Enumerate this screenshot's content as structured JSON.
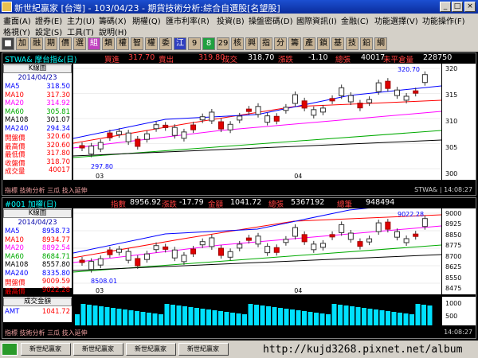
{
  "title": "新世紀贏家 [台灣] - 103/04/23 - 期貨技術分析:綜合自選股[名望股]",
  "menu1": [
    "畫面(A)",
    "證券(E)",
    "主力(U)",
    "籌碼(X)",
    "期權(Q)",
    "匯市利率(R)",
    "投資(B)",
    "操盤密碼(D)",
    "國際資訊(I)",
    "金融(C)",
    "功能選擇(V)",
    "功能操作(F)"
  ],
  "menu2": [
    "格視(Y)",
    "設定(S)",
    "工具(T)",
    "說明(H)"
  ],
  "toolbar": [
    "加",
    "融",
    "期",
    "價",
    "選",
    "組",
    "類",
    "權",
    "智",
    "權",
    "委",
    "江",
    "9",
    "8",
    "29",
    "核",
    "興",
    "指",
    "分",
    "籌",
    "產",
    "鎖",
    "基",
    "技",
    "鉛",
    "綱"
  ],
  "top": {
    "symbol": "STWA& 摩台指&(日)",
    "buy_label": "買進",
    "buy": "317.70",
    "sell_label": "賣出",
    "sell": "319.80",
    "deal_label": "成交",
    "deal": "318.70",
    "chg_label": "漲跌",
    "chg": "-1.10",
    "vol_label": "總張",
    "vol": "40017",
    "oi_label": "未平倉量",
    "oi": "228750",
    "header": "K線圖",
    "date": "2014/04/23",
    "rows": [
      {
        "label": "MA5",
        "value": "318.50",
        "color": "#0000ff"
      },
      {
        "label": "MA10",
        "value": "317.30",
        "color": "#ff0000"
      },
      {
        "label": "MA20",
        "value": "314.92",
        "color": "#ff00ff"
      },
      {
        "label": "MA60",
        "value": "305.81",
        "color": "#00aa00"
      },
      {
        "label": "MA108",
        "value": "301.07",
        "color": "#000000"
      },
      {
        "label": "MA240",
        "value": "294.34",
        "color": "#0000ff"
      },
      {
        "label": "開盤價",
        "value": "320.60",
        "color": "#ff0000"
      },
      {
        "label": "最高價",
        "value": "320.60",
        "color": "#ff0000"
      },
      {
        "label": "最低價",
        "value": "317.80",
        "color": "#ff0000"
      },
      {
        "label": "收盤價",
        "value": "318.70",
        "color": "#ff0000"
      },
      {
        "label": "成交量",
        "value": "40017",
        "color": "#ff0000"
      }
    ],
    "yticks": [
      "320",
      "315",
      "310",
      "305",
      "300"
    ],
    "xticks": [
      "03",
      "04"
    ],
    "annot_high": "320.70",
    "annot_low": "297.80",
    "status_left": "指標  技術分析 三瓜 技入延伸",
    "status_right": "STWA& | 14:08:27"
  },
  "bottom": {
    "symbol": "#001 加權(日)",
    "idx_label": "指數",
    "idx": "8956.92",
    "chg_label": "漲跌",
    "chg": "-17.79",
    "amt_label": "金額",
    "amt": "1041.72",
    "vol_label": "總張",
    "vol": "5367192",
    "cnt_label": "總筆",
    "cnt": "948494",
    "header": "K線圖",
    "date": "2014/04/23",
    "rows": [
      {
        "label": "MA5",
        "value": "8958.73",
        "color": "#0000ff"
      },
      {
        "label": "MA10",
        "value": "8934.77",
        "color": "#ff0000"
      },
      {
        "label": "MA20",
        "value": "8892.54",
        "color": "#ff00ff"
      },
      {
        "label": "MA60",
        "value": "8684.71",
        "color": "#00aa00"
      },
      {
        "label": "MA108",
        "value": "8557.80",
        "color": "#000000"
      },
      {
        "label": "MA240",
        "value": "8335.80",
        "color": "#0000ff"
      },
      {
        "label": "開盤價",
        "value": "9009.59",
        "color": "#ff0000"
      },
      {
        "label": "最高價",
        "value": "9022.28",
        "color": "#ff0000"
      }
    ],
    "yticks": [
      "9000",
      "8925",
      "8850",
      "8775",
      "8700",
      "8625",
      "8550",
      "8475"
    ],
    "xticks": [
      "03",
      "04"
    ],
    "annot_high": "9022.28",
    "annot_low": "8508.01",
    "sub_header": "成交金額",
    "sub_label": "AMT",
    "sub_value": "1041.72",
    "sub_yticks": [
      "1000",
      "500"
    ],
    "status_left": "指標  技術分析 三瓜 技入延伸",
    "status_right": "14:08:27"
  },
  "taskbar": [
    "新世紀贏家",
    "新世紀贏家",
    "新世紀贏家",
    "新世紀贏家"
  ],
  "url": "http://kujd3268.pixnet.net/album"
}
